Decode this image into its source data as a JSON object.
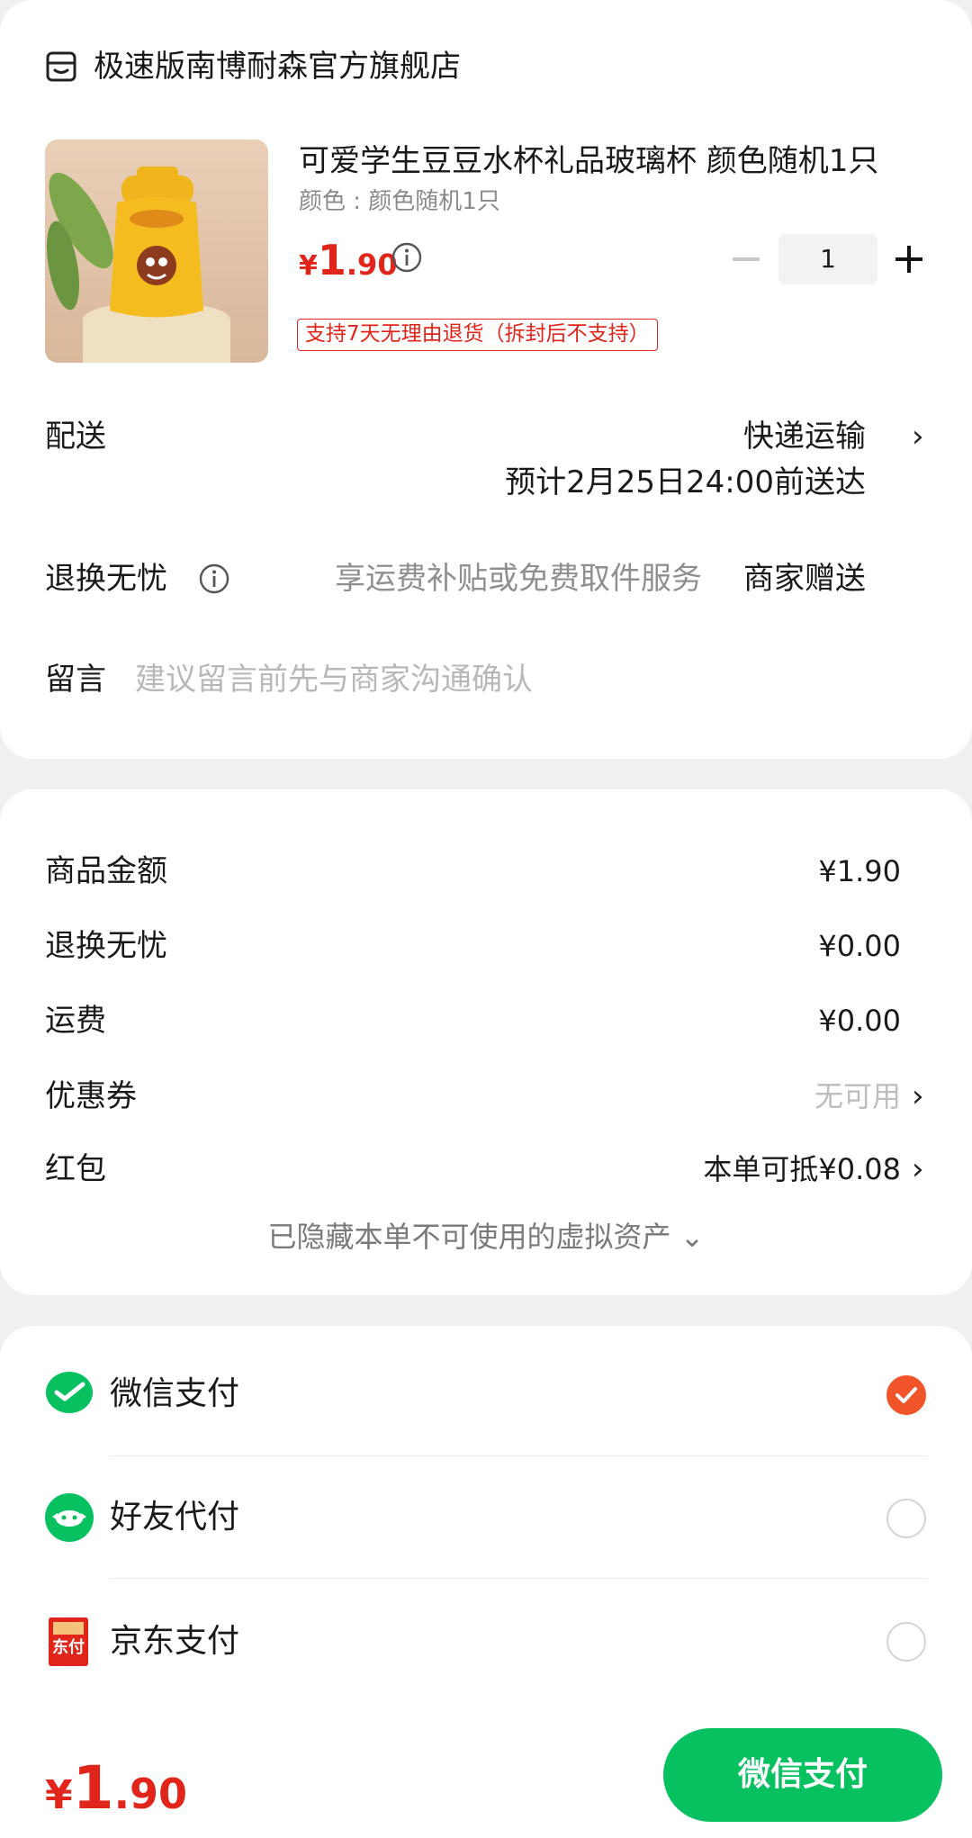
{
  "order": {
    "store_name": "极速版南博耐森官方旗舰店",
    "product": {
      "title": "可爱学生豆豆水杯礼品玻璃杯 颜色随机1只",
      "variant": "颜色 : 颜色随机1只",
      "price_yen": "¥",
      "price_int": "1",
      "price_dec": ".90",
      "quantity": "1",
      "return_policy": "支持7天无理由退货（拆封后不支持）",
      "icons": {
        "info": "info-icon",
        "minus": "minus-icon",
        "plus": "plus-icon"
      }
    },
    "delivery": {
      "label": "配送",
      "method": "快递运输",
      "eta": "预计2月25日24:00前送达"
    },
    "worry_free": {
      "label": "退换无忧",
      "service": "享运费补贴或免费取件服务",
      "gift": "商家赠送"
    },
    "message": {
      "label": "留言",
      "placeholder": "建议留言前先与商家沟通确认"
    }
  },
  "costs": {
    "items": [
      {
        "label": "商品金额",
        "value": "¥1.90"
      },
      {
        "label": "退换无忧",
        "value": "¥0.00"
      },
      {
        "label": "运费",
        "value": "¥0.00"
      },
      {
        "label": "优惠券",
        "value": "无可用"
      },
      {
        "label": "红包",
        "value": "本单可抵¥0.08"
      }
    ],
    "hidden_assets": "已隐藏本单不可使用的虚拟资产 ⌄"
  },
  "payment": {
    "methods": [
      {
        "label": "微信支付",
        "icon": "wechat-pay-icon",
        "selected": true
      },
      {
        "label": "好友代付",
        "icon": "friend-pay-icon",
        "selected": false
      },
      {
        "label": "京东支付",
        "icon": "jd-pay-icon",
        "selected": false
      }
    ],
    "jd_icon_text": "东付"
  },
  "bottom_bar": {
    "total_yen": "¥",
    "total_int": "1",
    "total_dec": ".90",
    "pay_button": "微信支付"
  },
  "colors": {
    "price_red": "#e1251b",
    "wechat_green": "#07c160",
    "selected_orange": "#f2542a"
  }
}
